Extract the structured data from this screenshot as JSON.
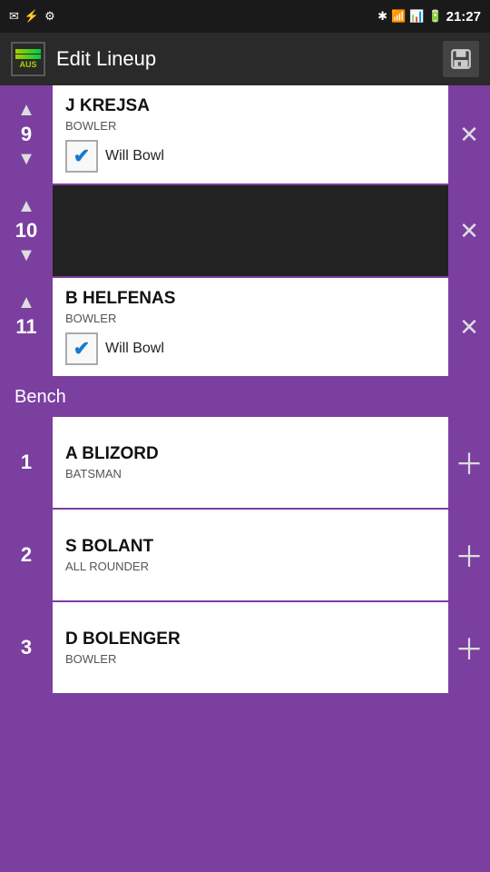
{
  "statusBar": {
    "time": "21:27",
    "icons": [
      "✉",
      "⚙",
      "⚡",
      "✱",
      "📶",
      "📊",
      "🔋"
    ]
  },
  "header": {
    "title": "Edit Lineup",
    "logoText": "AUS",
    "saveLabel": "💾"
  },
  "lineup": [
    {
      "position": "9",
      "name": "J KREJSA",
      "role": "BOWLER",
      "willBowl": true,
      "empty": false
    },
    {
      "position": "10",
      "name": "",
      "role": "",
      "willBowl": false,
      "empty": true
    },
    {
      "position": "11",
      "name": "B HELFENAS",
      "role": "BOWLER",
      "willBowl": true,
      "empty": false
    }
  ],
  "bench": {
    "label": "Bench",
    "players": [
      {
        "position": "1",
        "name": "A BLIZORD",
        "role": "BATSMAN"
      },
      {
        "position": "2",
        "name": "S BOLANT",
        "role": "ALL ROUNDER"
      },
      {
        "position": "3",
        "name": "D BOLENGER",
        "role": "BOWLER"
      }
    ]
  },
  "labels": {
    "willBowl": "Will Bowl",
    "checkmark": "✔"
  }
}
